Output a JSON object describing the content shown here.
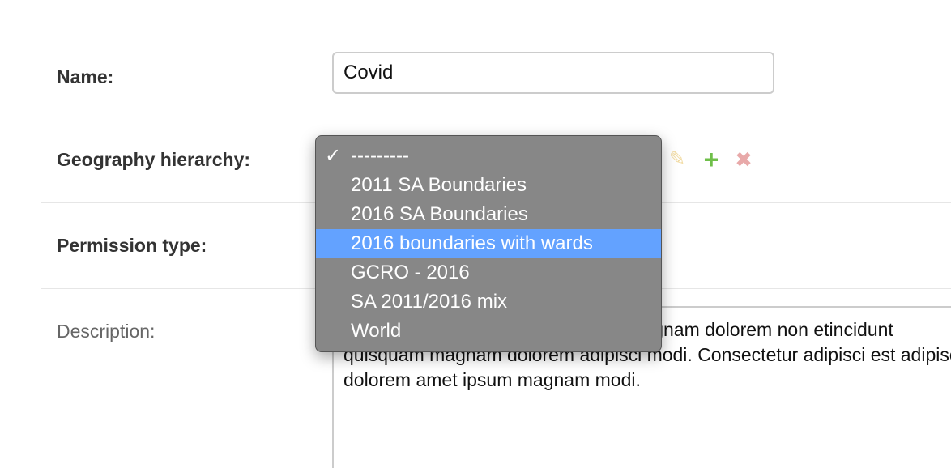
{
  "form": {
    "name": {
      "label": "Name:",
      "value": "Covid"
    },
    "geography_hierarchy": {
      "label": "Geography hierarchy:",
      "options": [
        {
          "label": "---------",
          "selected": true,
          "highlighted": false
        },
        {
          "label": "2011 SA Boundaries",
          "selected": false,
          "highlighted": false
        },
        {
          "label": "2016 SA Boundaries",
          "selected": false,
          "highlighted": false
        },
        {
          "label": "2016 boundaries with wards",
          "selected": false,
          "highlighted": true
        },
        {
          "label": "GCRO - 2016",
          "selected": false,
          "highlighted": false
        },
        {
          "label": "SA 2011/2016 mix",
          "selected": false,
          "highlighted": false
        },
        {
          "label": "World",
          "selected": false,
          "highlighted": false
        }
      ],
      "actions": {
        "edit_icon": "✎",
        "add_icon": "+",
        "delete_icon": "✖"
      }
    },
    "permission_type": {
      "label": "Permission type:"
    },
    "description": {
      "label": "Description:",
      "value": "Dolor velit sit ipsum etincidunt. Sit magnam dolorem non etincidunt quisquam magnam dolorem adipisci modi. Consectetur adipisci est adipisci dolorem amet ipsum magnam modi."
    }
  },
  "colors": {
    "dropdown_bg": "#878787",
    "highlight": "#63a2ff",
    "add_icon": "#6fbf4a",
    "edit_icon": "#f2dca5",
    "delete_icon": "#e8a9a9"
  }
}
